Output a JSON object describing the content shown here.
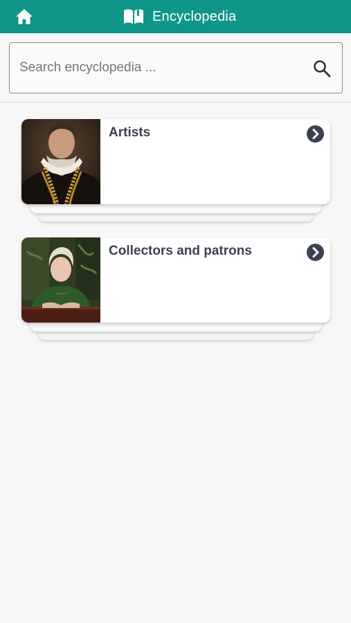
{
  "header": {
    "title": "Encyclopedia",
    "home_icon": "home-icon",
    "title_icon": "open-book-icon",
    "background_color": "#0f9688"
  },
  "search": {
    "placeholder": "Search encyclopedia ...",
    "value": "",
    "icon": "search-icon"
  },
  "categories": [
    {
      "label": "Artists",
      "thumbnail": "portrait-bearded-man-with-gold-chain",
      "chevron_icon": "chevron-right-circle-icon"
    },
    {
      "label": "Collectors and patrons",
      "thumbnail": "portrait-woman-in-green-dress",
      "chevron_icon": "chevron-right-circle-icon"
    }
  ]
}
